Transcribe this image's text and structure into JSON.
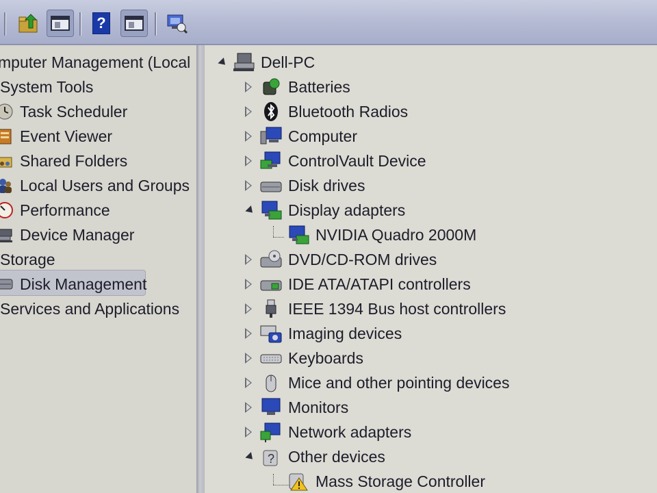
{
  "toolbar": {
    "help_label": "?",
    "buttons": [
      "up-folder",
      "show-hide-tree",
      "help",
      "show-hide-action",
      "scan-hardware"
    ]
  },
  "left_tree": {
    "root": "mputer Management (Local",
    "system_tools": "System Tools",
    "task_scheduler": "Task Scheduler",
    "event_viewer": "Event Viewer",
    "shared_folders": "Shared Folders",
    "local_users": "Local Users and Groups",
    "performance": "Performance",
    "device_manager": "Device Manager",
    "storage": "Storage",
    "disk_management": "Disk Management",
    "services": "Services and Applications"
  },
  "device_tree": {
    "root": "Dell-PC",
    "batteries": "Batteries",
    "bluetooth": "Bluetooth Radios",
    "computer": "Computer",
    "controlvault": "ControlVault Device",
    "disk_drives": "Disk drives",
    "display_adapters": "Display adapters",
    "nvidia": "NVIDIA Quadro 2000M",
    "dvd": "DVD/CD-ROM drives",
    "ide": "IDE ATA/ATAPI controllers",
    "ieee": "IEEE 1394 Bus host controllers",
    "imaging": "Imaging devices",
    "keyboards": "Keyboards",
    "mice": "Mice and other pointing devices",
    "monitors": "Monitors",
    "network": "Network adapters",
    "other": "Other devices",
    "mass_storage": "Mass Storage Controller"
  },
  "colors": {
    "toolbar": "#b3b9d2",
    "pane": "#dcdbd4",
    "selection": "#c2c4cd",
    "text": "#1d1d2a"
  }
}
